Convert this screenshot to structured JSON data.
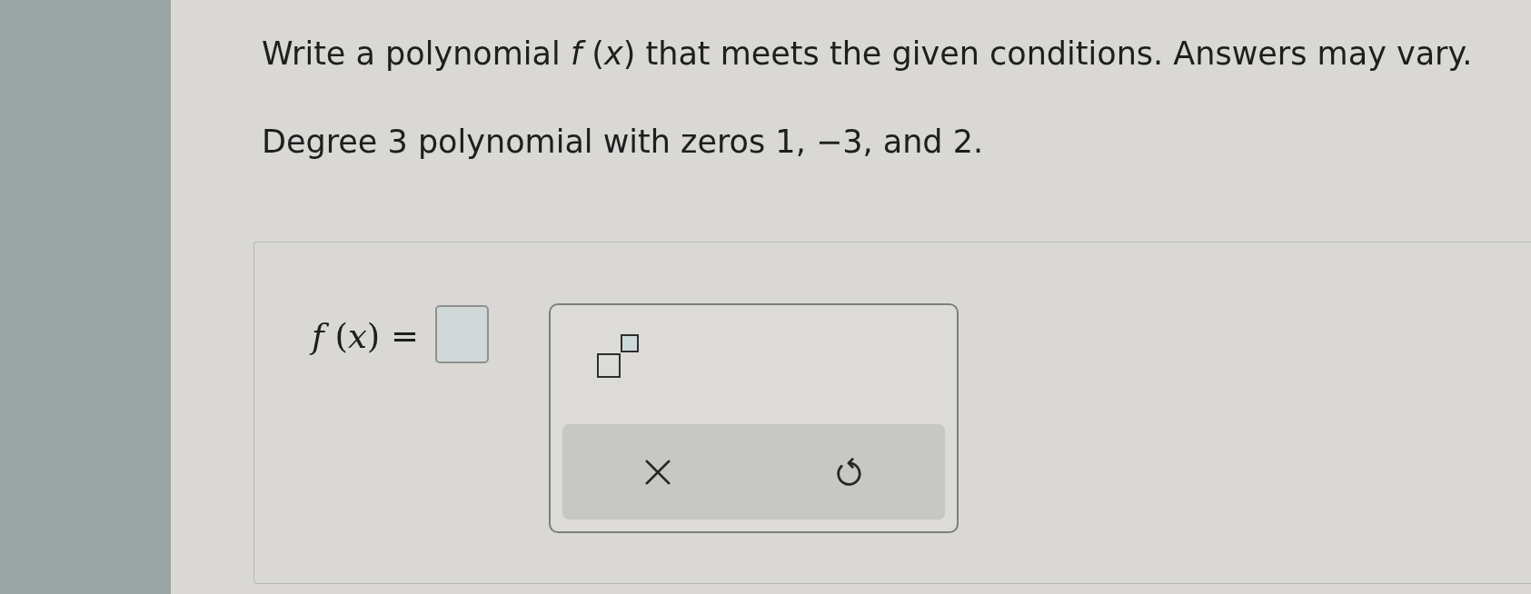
{
  "instructions": "Write a polynomial *f* (*x*) that meets the given conditions. Answers may vary.",
  "problem": "Degree 3 polynomial with zeros 1, −3, and 2.",
  "answer": {
    "label": "*f* (*x*) ="
  },
  "keypad": {
    "templates": [
      {
        "kind": "exponent"
      }
    ],
    "actions": [
      {
        "kind": "clear"
      },
      {
        "kind": "undo"
      }
    ]
  }
}
